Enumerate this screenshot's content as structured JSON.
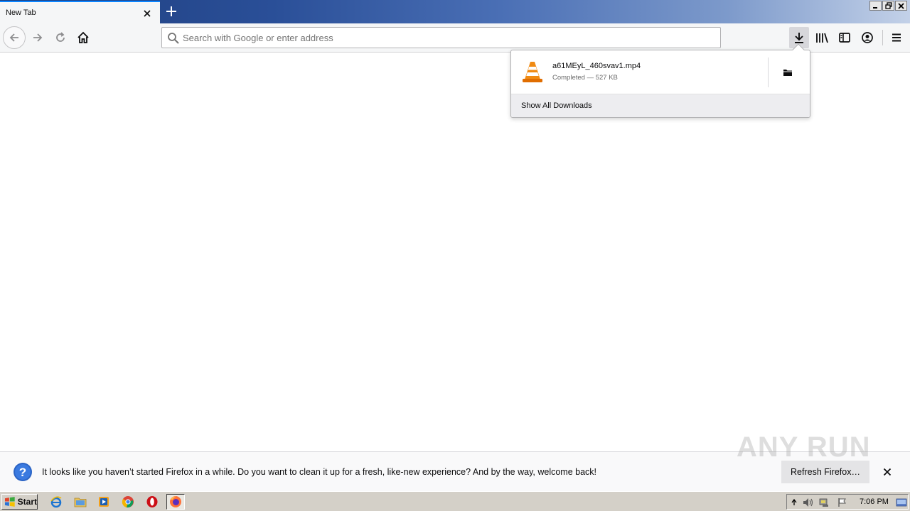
{
  "browser": {
    "tab": {
      "title": "New Tab"
    },
    "urlbar": {
      "placeholder": "Search with Google or enter address",
      "value": ""
    }
  },
  "downloads_panel": {
    "item": {
      "filename": "a61MEyL_460svav1.mp4",
      "status": "Completed — 527 KB"
    },
    "show_all_label": "Show All Downloads"
  },
  "notification": {
    "message": "It looks like you haven’t started Firefox in a while. Do you want to clean it up for a fresh, like-new experience? And by the way, welcome back!",
    "button_label": "Refresh Firefox…"
  },
  "watermark": "ANY RUN",
  "taskbar": {
    "start_label": "Start",
    "apps": [
      "ie-icon",
      "explorer-icon",
      "media-player-icon",
      "chrome-icon",
      "opera-icon",
      "firefox-icon"
    ],
    "clock": "7:06 PM"
  },
  "colors": {
    "accent": "#0a84ff",
    "title_gradient_start": "#1e3d7c",
    "title_gradient_end": "#c3d1e8",
    "toolbar_bg": "#f5f6f7",
    "taskbar_bg": "#d4d0c8"
  }
}
